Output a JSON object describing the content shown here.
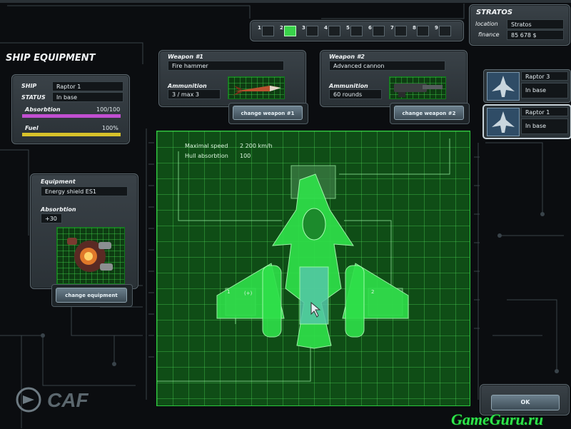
{
  "header": {
    "title": "SHIP EQUIPMENT",
    "brand": "CAF"
  },
  "tabs": [
    "1",
    "2",
    "3",
    "4",
    "5",
    "6",
    "7",
    "8",
    "9"
  ],
  "active_tab": 1,
  "status": {
    "name": "STRATOS",
    "location_label": "location",
    "location_value": "Stratos",
    "finance_label": "finance",
    "finance_value": "85 678 $"
  },
  "ship": {
    "ship_label": "SHIP",
    "ship_value": "Raptor 1",
    "status_label": "STATUS",
    "status_value": "In base",
    "absorption_label": "Absorbtion",
    "absorption_value": "100/100",
    "absorption_fraction": 1.0,
    "absorption_color": "#c14fd0",
    "fuel_label": "Fuel",
    "fuel_value": "100%",
    "fuel_fraction": 1.0,
    "fuel_color": "#d8c22a"
  },
  "weapon1": {
    "label": "Weapon #1",
    "name": "Fire hammer",
    "ammo_label": "Ammunition",
    "ammo_value": "3 / max 3",
    "button": "change weapon #1",
    "icon": "missile-icon"
  },
  "weapon2": {
    "label": "Weapon #2",
    "name": "Advanced cannon",
    "ammo_label": "Ammunition",
    "ammo_value": "60 rounds",
    "button": "change weapon #2",
    "icon": "cannon-icon"
  },
  "equipment": {
    "label": "Equipment",
    "name": "Energy shield ES1",
    "absorption_label": "Absorbtion",
    "absorption_value": "+30",
    "button": "change equipment",
    "icon": "shield-generator-icon"
  },
  "stats": {
    "speed_label": "Maximal speed",
    "speed_value": "2 200 km/h",
    "hull_label": "Hull absorbtion",
    "hull_value": "100"
  },
  "slot_labels": {
    "left_slot": "1",
    "left_slot_badge": "(+)",
    "right_slot": "2"
  },
  "fleet": [
    {
      "name": "Raptor 3",
      "status": "In base",
      "selected": false
    },
    {
      "name": "Raptor 1",
      "status": "In base",
      "selected": true
    }
  ],
  "ok_button": "OK",
  "watermark": "GameGuru.ru",
  "colors": {
    "accent_green": "#2bc93c",
    "panel": "#3a4248"
  }
}
